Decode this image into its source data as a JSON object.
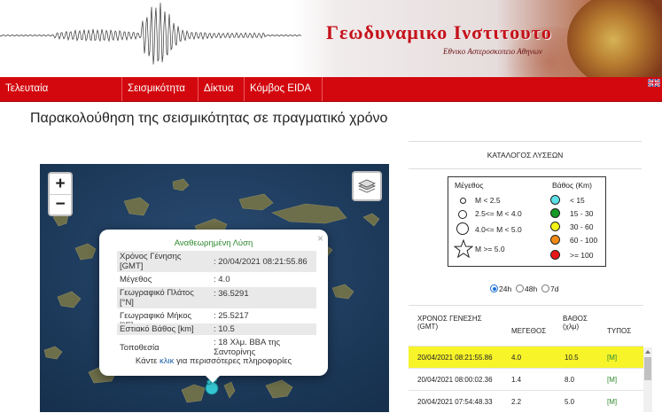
{
  "header": {
    "title": "Γεωδυναμικο Ινστιτουτο",
    "subtitle": "Εθνικο Αστεροσκοπειο Αθηνων"
  },
  "nav": {
    "items": [
      {
        "label": "Τελευταία Ανακοινωθέντα"
      },
      {
        "label": "Σεισμικότητα"
      },
      {
        "label": "Δίκτυα"
      },
      {
        "label": "Κόμβος EIDA"
      }
    ]
  },
  "page_title": "Παρακολούθηση της σεισμικότητας σε πραγματικό χρόνο",
  "map": {
    "zoom_in": "+",
    "zoom_out": "−",
    "popup": {
      "close": "×",
      "title": "Αναθεωρημένη Λύση",
      "rows": [
        {
          "label": "Χρόνος Γένησης [GMT]",
          "value": ": 20/04/2021 08:21:55.86"
        },
        {
          "label": "Μέγεθος",
          "value": ": 4.0"
        },
        {
          "label": "Γεωγραφικό Πλάτος [°N]",
          "value": ": 36.5291"
        },
        {
          "label": "Γεωγραφικό Μήκος [°E]",
          "value": ": 25.5217"
        },
        {
          "label": "Εστιακό Βάθος [km]",
          "value": ": 10.5"
        },
        {
          "label": "Τοποθεσία",
          "value": ": 18 Χλμ. ΒΒΑ της Σαντορίνης"
        }
      ],
      "more_before": "Κάντε",
      "more_link": "κλικ",
      "more_after": "για περισσότερες πληροφορίες"
    }
  },
  "catalog": {
    "title": "ΚΑΤΑΛΟΓΟΣ ΛΥΣΕΩΝ",
    "legend": {
      "magnitude_title": "Μέγεθος",
      "magnitude_items": [
        "M < 2.5",
        "2.5<= M < 4.0",
        "4.0<= M < 5.0",
        "M >= 5.0"
      ],
      "depth_title": "Βάθος (Km)",
      "depth_items": [
        {
          "label": "< 15",
          "color": "#5ee0e8"
        },
        {
          "label": "15 - 30",
          "color": "#159a25"
        },
        {
          "label": "30 - 60",
          "color": "#f2f218"
        },
        {
          "label": "60 - 100",
          "color": "#f28a13"
        },
        {
          "label": ">= 100",
          "color": "#e81717"
        }
      ]
    },
    "period_options": [
      "24h",
      "48h",
      "7d"
    ],
    "period_selected": "24h",
    "columns": [
      "ΧΡΟΝΟΣ ΓΕΝΕΣΗΣ (GMT)",
      "ΜΕΓΕΘΟΣ",
      "ΒΑΘΟΣ (χλμ)",
      "ΤΥΠΟΣ"
    ],
    "events": [
      {
        "time": "20/04/2021 08:21:55.86",
        "magnitude": "4.0",
        "depth": "10.5",
        "type": "[M]",
        "highlighted": true
      },
      {
        "time": "20/04/2021 08:00:02.36",
        "magnitude": "1.4",
        "depth": "8.0",
        "type": "[M]",
        "highlighted": false
      },
      {
        "time": "20/04/2021 07:54:48.33",
        "magnitude": "2.2",
        "depth": "5.0",
        "type": "[M]",
        "highlighted": false
      }
    ]
  },
  "colors": {
    "brand_red": "#d2080e",
    "title_red": "#c4111a",
    "highlight": "#f7f42a",
    "event_marker": "#35c6d3"
  }
}
